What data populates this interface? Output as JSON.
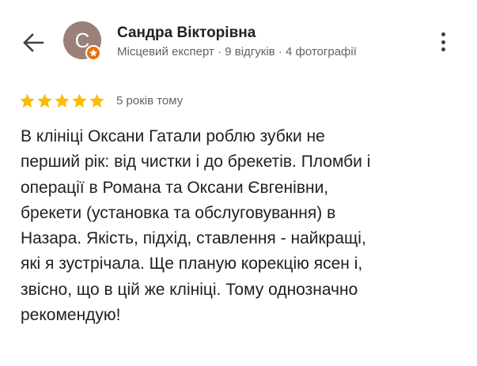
{
  "header": {
    "reviewer_name": "Сандра Вікторівна",
    "avatar_initial": "С",
    "reviewer_meta": "Місцевий експерт · 9 відгуків · 4 фотографії",
    "avatar_color": "#9a8078",
    "badge_color": "#e8710a",
    "back_icon": "arrow-back-icon",
    "more_icon": "more-vertical-icon"
  },
  "review": {
    "rating": 5,
    "rating_max": 5,
    "star_color": "#fbbc04",
    "date": "5 років тому",
    "lines": [
      "В клініці Оксани Гатали роблю зубки не",
      "перший рік: від чистки і до брекетів. Пломби і",
      "операції в Романа та Оксани Євгенівни,",
      "брекети (установка та обслуговування) в",
      "Назара. Якість, підхід, ставлення - найкращі,",
      "які я зустрічала. Ще планую корекцію ясен і,",
      "звісно, що в цій же клініці. Тому однозначно",
      "рекомендую!"
    ]
  }
}
